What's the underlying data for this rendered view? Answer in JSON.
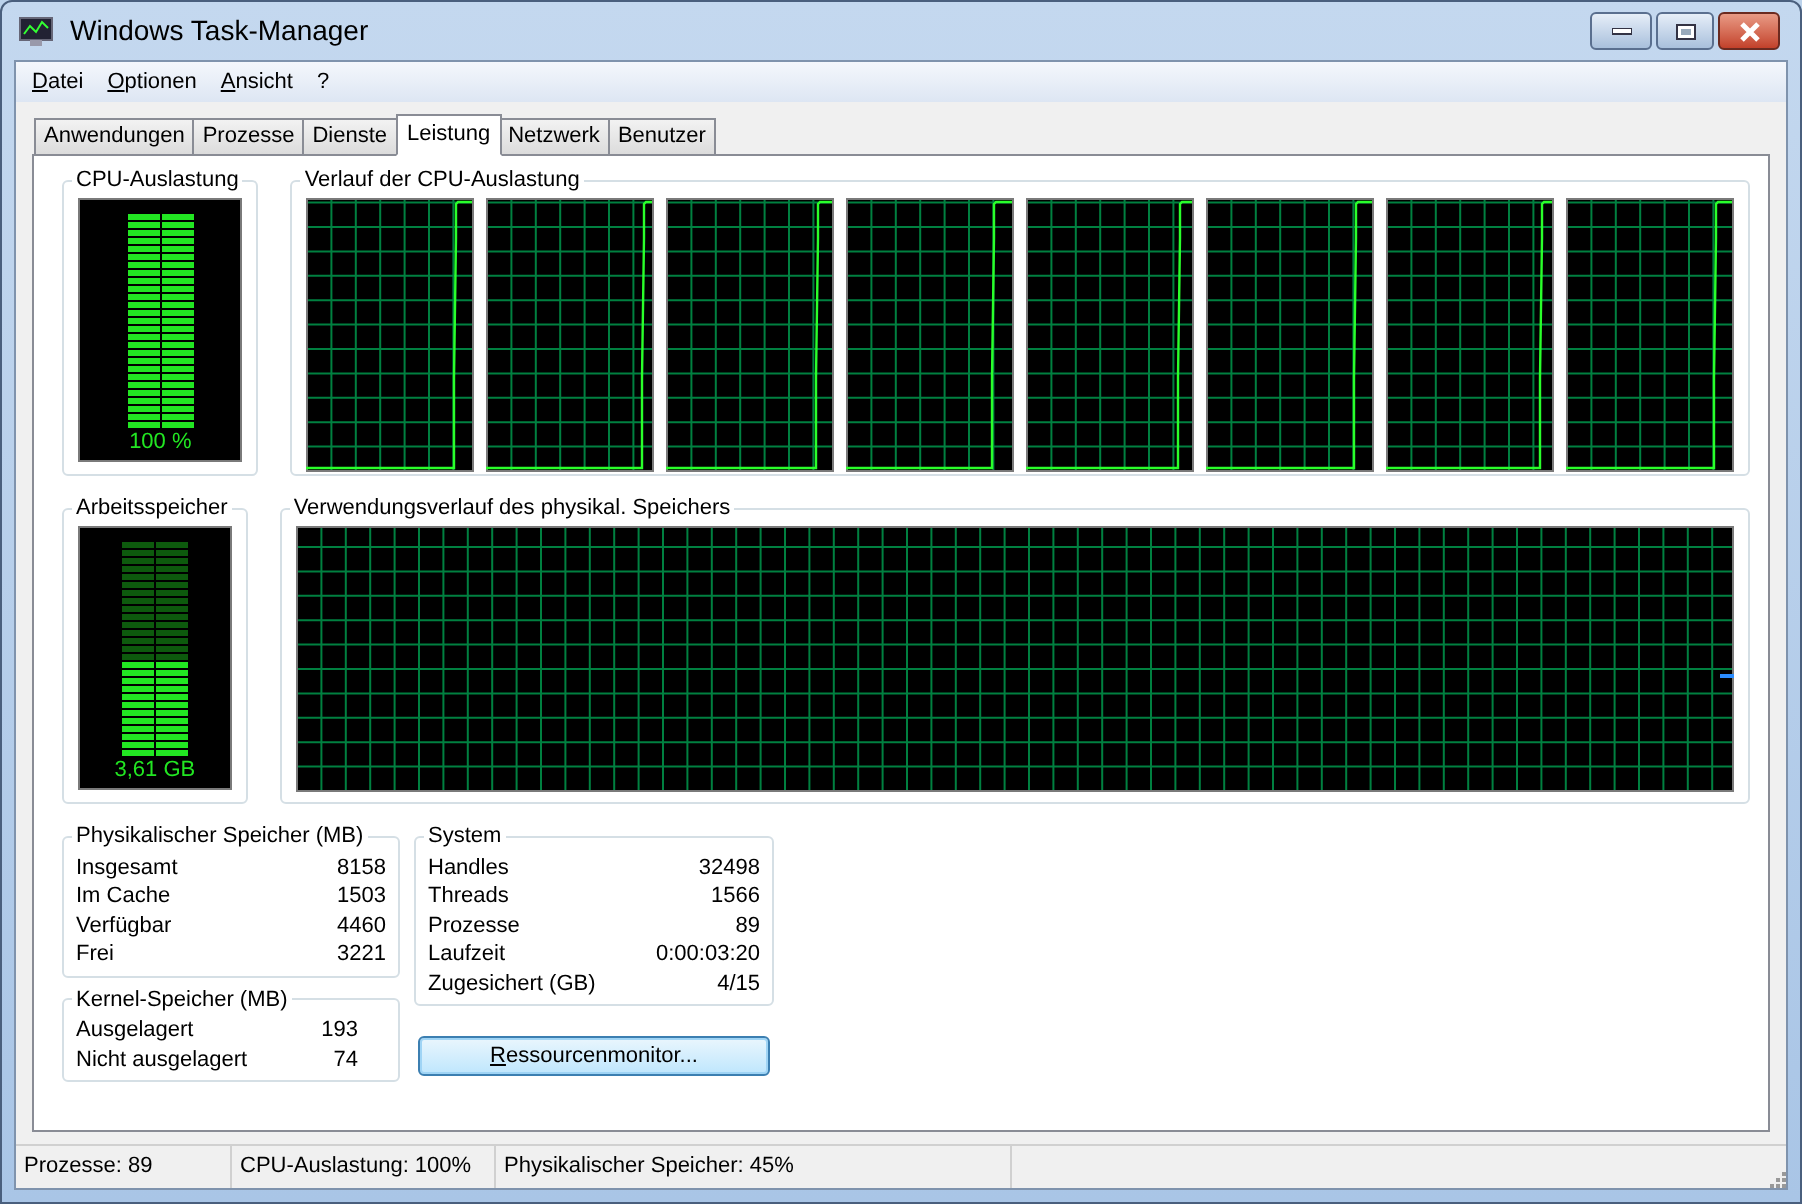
{
  "window": {
    "title": "Windows Task-Manager"
  },
  "menu": [
    "Datei",
    "Optionen",
    "Ansicht",
    "?"
  ],
  "tabs": [
    {
      "label": "Anwendungen",
      "selected": false
    },
    {
      "label": "Prozesse",
      "selected": false
    },
    {
      "label": "Dienste",
      "selected": false
    },
    {
      "label": "Leistung",
      "selected": true
    },
    {
      "label": "Netzwerk",
      "selected": false
    },
    {
      "label": "Benutzer",
      "selected": false
    }
  ],
  "cpu": {
    "title": "CPU-Auslastung",
    "meter": {
      "level": 1,
      "reading": "100 %"
    },
    "history_title": "Verlauf der CPU-Auslastung"
  },
  "memory": {
    "title": "Arbeitsspeicher",
    "meter": {
      "level": 0.45,
      "reading": "3,61 GB"
    },
    "history_title": "Verwendungsverlauf des physikal. Speichers"
  },
  "physical_memory": {
    "title": "Physikalischer Speicher (MB)",
    "rows": [
      {
        "label": "Insgesamt",
        "value": "8158"
      },
      {
        "label": "Im Cache",
        "value": "1503"
      },
      {
        "label": "Verfügbar",
        "value": "4460"
      },
      {
        "label": "Frei",
        "value": "3221"
      }
    ]
  },
  "kernel_memory": {
    "title": "Kernel-Speicher (MB)",
    "rows": [
      {
        "label": "Ausgelagert",
        "value": "193"
      },
      {
        "label": "Nicht ausgelagert",
        "value": "74"
      }
    ]
  },
  "system": {
    "title": "System",
    "rows": [
      {
        "label": "Handles",
        "value": "32498"
      },
      {
        "label": "Threads",
        "value": "1566"
      },
      {
        "label": "Prozesse",
        "value": "89"
      },
      {
        "label": "Laufzeit",
        "value": "0:00:03:20"
      },
      {
        "label": "Zugesichert (GB)",
        "value": "4/15"
      }
    ]
  },
  "button": "Ressourcenmonitor...",
  "status_bar": [
    "Prozesse: 89",
    "CPU-Auslastung: 100%",
    "Physikalischer Speicher: 45%"
  ]
}
